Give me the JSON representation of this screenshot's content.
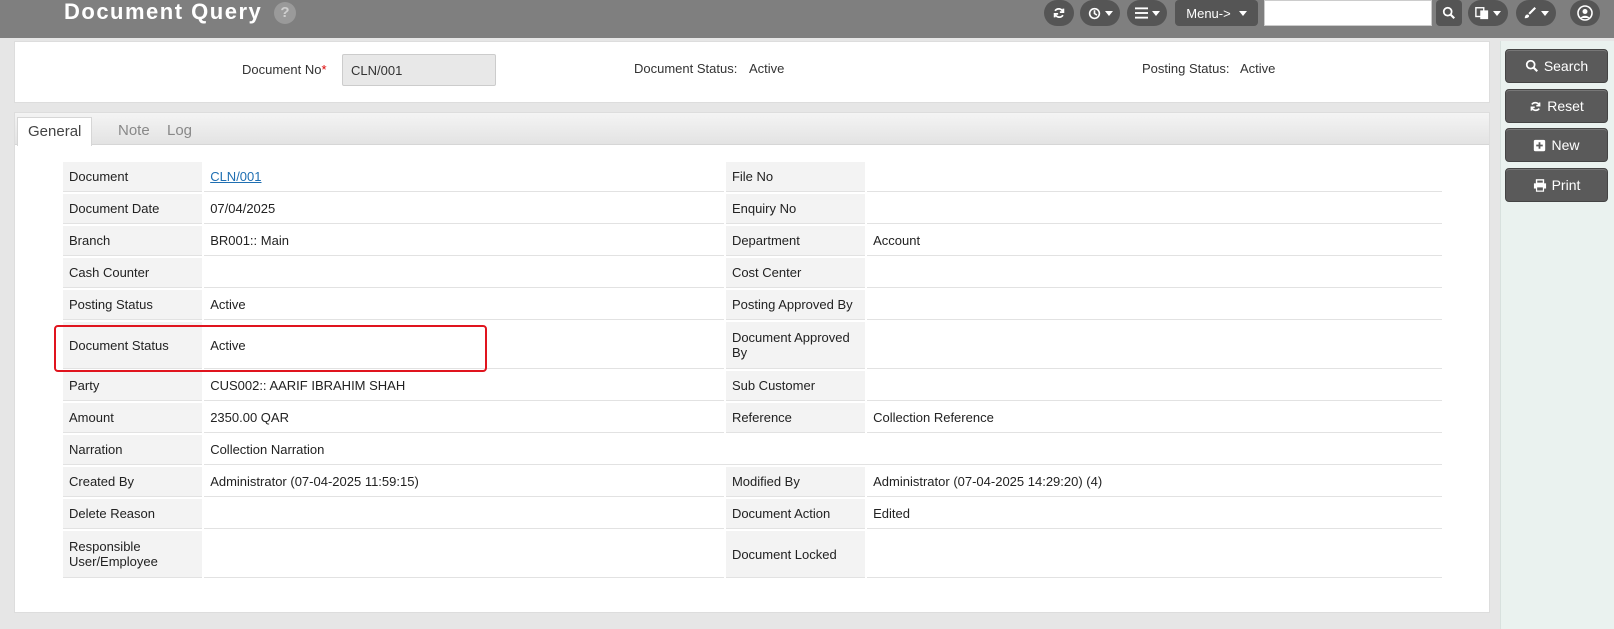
{
  "header": {
    "title": "Document Query",
    "help_glyph": "?",
    "menu_label": "Menu->",
    "search_value": ""
  },
  "filter": {
    "doc_no_label": "Document No",
    "required_mark": "*",
    "doc_no_value": "CLN/001",
    "doc_status_label": "Document Status:",
    "doc_status_value": "Active",
    "posting_status_label": "Posting Status:",
    "posting_status_value": "Active"
  },
  "tabs": [
    {
      "label": "General"
    },
    {
      "label": "Note"
    },
    {
      "label": "Log"
    }
  ],
  "details": {
    "document_label": "Document",
    "document_value": "CLN/001",
    "file_no_label": "File No",
    "file_no_value": "",
    "document_date_label": "Document Date",
    "document_date_value": "07/04/2025",
    "enquiry_no_label": "Enquiry No",
    "enquiry_no_value": "",
    "branch_label": "Branch",
    "branch_value": "BR001:: Main",
    "department_label": "Department",
    "department_value": "Account",
    "cash_counter_label": "Cash Counter",
    "cash_counter_value": "",
    "cost_center_label": "Cost Center",
    "cost_center_value": "",
    "posting_status_label": "Posting Status",
    "posting_status_value": "Active",
    "posting_approved_label": "Posting Approved By",
    "posting_approved_value": "",
    "document_status_label": "Document Status",
    "document_status_value": "Active",
    "document_approved_label": "Document Approved By",
    "document_approved_value": "",
    "party_label": "Party",
    "party_value": "CUS002:: AARIF IBRAHIM SHAH",
    "sub_customer_label": "Sub Customer",
    "sub_customer_value": "",
    "amount_label": "Amount",
    "amount_value": "2350.00 QAR",
    "reference_label": "Reference",
    "reference_value": "Collection Reference",
    "narration_label": "Narration",
    "narration_value": "Collection Narration",
    "created_by_label": "Created By",
    "created_by_value": "Administrator (07-04-2025 11:59:15)",
    "modified_by_label": "Modified By",
    "modified_by_value": "Administrator (07-04-2025 14:29:20) (4)",
    "delete_reason_label": "Delete Reason",
    "delete_reason_value": "",
    "document_action_label": "Document Action",
    "document_action_value": "Edited",
    "responsible_label": "Responsible User/Employee",
    "responsible_value": "",
    "document_locked_label": "Document Locked",
    "document_locked_value": ""
  },
  "actions": {
    "search_label": "Search",
    "reset_label": "Reset",
    "new_label": "New",
    "print_label": "Print"
  },
  "icons": [
    "refresh-icon",
    "history-icon",
    "menu-icon",
    "search-icon",
    "language-icon",
    "brush-icon",
    "user-icon",
    "plus-icon",
    "print-icon"
  ],
  "colors": {
    "accent_link": "#1f6fb2",
    "highlight": "#e0141e",
    "header_bg": "#7f7f7f"
  }
}
